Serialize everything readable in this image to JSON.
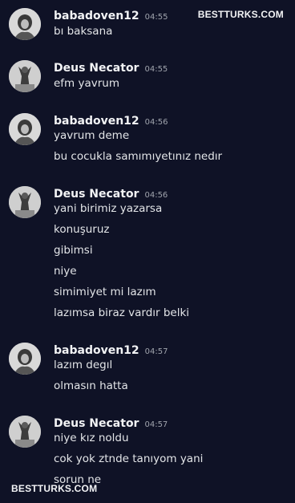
{
  "watermark": {
    "top": "BESTTURKS.COM",
    "bottom": "BESTTURKS.COM"
  },
  "groups": [
    {
      "avatar": "user-babadoven12-avatar",
      "username": "babadoven12",
      "time": "04:55",
      "messages": [
        "bı baksana"
      ]
    },
    {
      "avatar": "user-deus-necator-avatar",
      "username": "Deus Necator",
      "time": "04:55",
      "messages": [
        "efm yavrum"
      ]
    },
    {
      "avatar": "user-babadoven12-avatar",
      "username": "babadoven12",
      "time": "04:56",
      "messages": [
        "yavrum deme",
        "bu cocukla samımıyetınız nedır"
      ]
    },
    {
      "avatar": "user-deus-necator-avatar",
      "username": "Deus Necator",
      "time": "04:56",
      "messages": [
        "yani birimiz yazarsa",
        "konuşuruz",
        "gibimsi",
        "niye",
        "simimiyet mi lazım",
        "lazımsa biraz vardır belki"
      ]
    },
    {
      "avatar": "user-babadoven12-avatar",
      "username": "babadoven12",
      "time": "04:57",
      "messages": [
        "lazım degıl",
        "olmasın hatta"
      ]
    },
    {
      "avatar": "user-deus-necator-avatar",
      "username": "Deus Necator",
      "time": "04:57",
      "messages": [
        "niye kız noldu",
        "cok yok ztnde tanıyom yani",
        "sorun ne"
      ]
    }
  ]
}
